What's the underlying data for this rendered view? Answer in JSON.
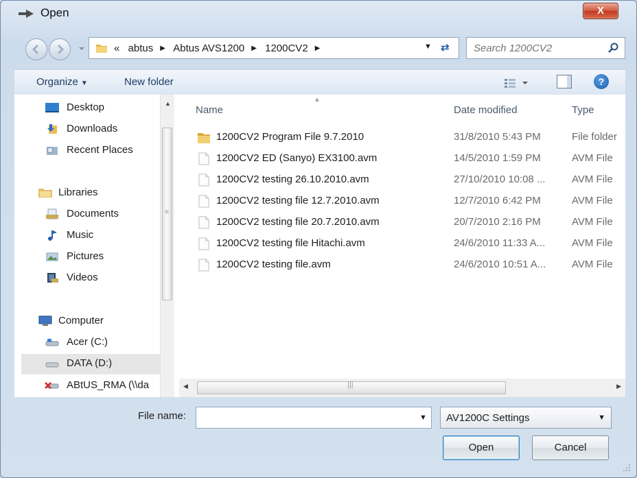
{
  "window": {
    "title": "Open",
    "close_label": "X"
  },
  "address": {
    "prefix": "«",
    "crumbs": [
      "abtus",
      "Abtus AVS1200",
      "1200CV2"
    ]
  },
  "search": {
    "placeholder": "Search 1200CV2"
  },
  "toolbar": {
    "organize_label": "Organize",
    "new_folder_label": "New folder",
    "help_label": "?"
  },
  "nav": {
    "items": [
      {
        "label": "Desktop",
        "icon": "desktop-icon"
      },
      {
        "label": "Downloads",
        "icon": "downloads-icon"
      },
      {
        "label": "Recent Places",
        "icon": "recent-places-icon"
      },
      {
        "label": "Libraries",
        "icon": "libraries-icon"
      },
      {
        "label": "Documents",
        "icon": "documents-icon"
      },
      {
        "label": "Music",
        "icon": "music-icon"
      },
      {
        "label": "Pictures",
        "icon": "pictures-icon"
      },
      {
        "label": "Videos",
        "icon": "videos-icon"
      },
      {
        "label": "Computer",
        "icon": "computer-icon"
      },
      {
        "label": "Acer (C:)",
        "icon": "drive-icon"
      },
      {
        "label": "DATA (D:)",
        "icon": "drive-icon"
      },
      {
        "label": "ABtUS_RMA (\\\\da",
        "icon": "network-drive-icon"
      }
    ],
    "selected": "DATA (D:)"
  },
  "files": {
    "columns": {
      "name": "Name",
      "date": "Date modified",
      "type": "Type"
    },
    "rows": [
      {
        "name": "1200CV2 Program File 9.7.2010",
        "date": "31/8/2010 5:43 PM",
        "type": "File folder",
        "kind": "folder"
      },
      {
        "name": "1200CV2 ED (Sanyo) EX3100.avm",
        "date": "14/5/2010 1:59 PM",
        "type": "AVM File",
        "kind": "file"
      },
      {
        "name": "1200CV2 testing 26.10.2010.avm",
        "date": "27/10/2010 10:08 ...",
        "type": "AVM File",
        "kind": "file"
      },
      {
        "name": "1200CV2 testing file 12.7.2010.avm",
        "date": "12/7/2010 6:42 PM",
        "type": "AVM File",
        "kind": "file"
      },
      {
        "name": "1200CV2 testing file 20.7.2010.avm",
        "date": "20/7/2010 2:16 PM",
        "type": "AVM File",
        "kind": "file"
      },
      {
        "name": "1200CV2 testing file Hitachi.avm",
        "date": "24/6/2010 11:33 A...",
        "type": "AVM File",
        "kind": "file"
      },
      {
        "name": "1200CV2 testing file.avm",
        "date": "24/6/2010 10:51 A...",
        "type": "AVM File",
        "kind": "file"
      }
    ]
  },
  "bottom": {
    "file_name_label": "File name:",
    "file_name_value": "",
    "filter_value": "AV1200C Settings",
    "open_label": "Open",
    "cancel_label": "Cancel"
  },
  "colors": {
    "frame": "#cddcec",
    "close": "#c0391f",
    "link": "#1e3b66"
  }
}
